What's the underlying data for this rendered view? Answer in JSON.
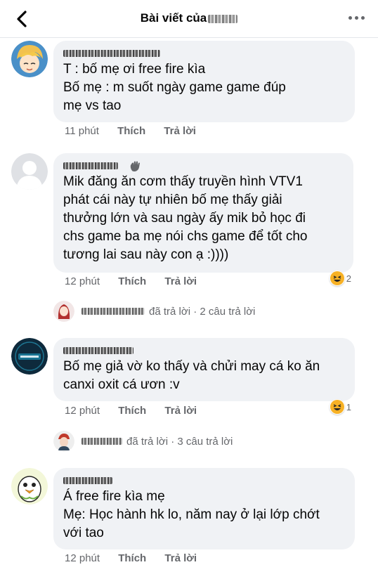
{
  "header": {
    "title": "Bài viết của"
  },
  "comments": [
    {
      "text": "T : bố mẹ ơi free fire kìa\nBố mẹ : m suốt ngày game game đúp\nmẹ vs tao",
      "time": "11 phút",
      "like": "Thích",
      "reply": "Trả lời"
    },
    {
      "text": "Mik đăng ăn cơm thấy truyền hình VTV1\nphát cái này  tự nhiên bố mẹ thấy giải\nthưởng lớn và sau ngày ấy mik bỏ học đi\nchs game ba mẹ nói  chs game để tốt cho\ntương lai sau này con ạ :))))",
      "time": "12 phút",
      "like": "Thích",
      "reply": "Trả lời",
      "reaction": {
        "icon": "haha-emoji-icon",
        "count": "2"
      },
      "replies_summary": "đã trả lời · 2 câu trả lời"
    },
    {
      "text": "Bố mẹ giả vờ ko thấy và chửi may cá ko ăn\ncanxi oxit cá ươn :v",
      "time": "12 phút",
      "like": "Thích",
      "reply": "Trả lời",
      "reaction": {
        "icon": "haha-emoji-icon",
        "count": "1"
      },
      "replies_summary": "đã trả lời · 3 câu trả lời"
    },
    {
      "text": "Á free fire kìa mẹ\nMẹ: Học hành hk lo, năm nay ở lại lớp chớt\nvới tao",
      "time": "12 phút",
      "like": "Thích",
      "reply": "Trả lời"
    }
  ],
  "colors": {
    "bubble": "#f0f2f5",
    "meta": "#65676b",
    "text": "#050505"
  }
}
